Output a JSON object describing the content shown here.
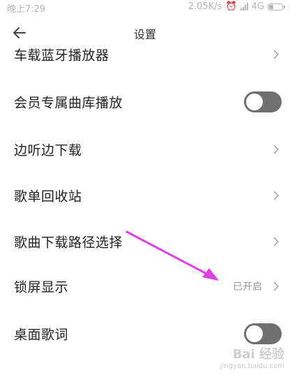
{
  "status_bar": {
    "time": "晚上7:29",
    "network_speed": "2.05K/s",
    "network_type": "4G"
  },
  "header": {
    "title": "设置",
    "back_icon": "arrow-left-icon"
  },
  "settings": [
    {
      "label": "车载蓝牙播放器",
      "type": "link"
    },
    {
      "label": "会员专属曲库播放",
      "type": "toggle",
      "enabled": false
    },
    {
      "label": "边听边下载",
      "type": "link"
    },
    {
      "label": "歌单回收站",
      "type": "link"
    },
    {
      "label": "歌曲下载路径选择",
      "type": "link"
    },
    {
      "label": "锁屏显示",
      "type": "link",
      "value": "已开启"
    },
    {
      "label": "桌面歌词",
      "type": "toggle",
      "enabled": false
    }
  ],
  "colors": {
    "toggle_off": "#6f6f6f",
    "annotation_arrow": "#e040e6",
    "secondary_text": "#9a9a9a"
  },
  "watermark": {
    "brand": "Bai 经验",
    "url": "jingyan.baidu.com"
  }
}
